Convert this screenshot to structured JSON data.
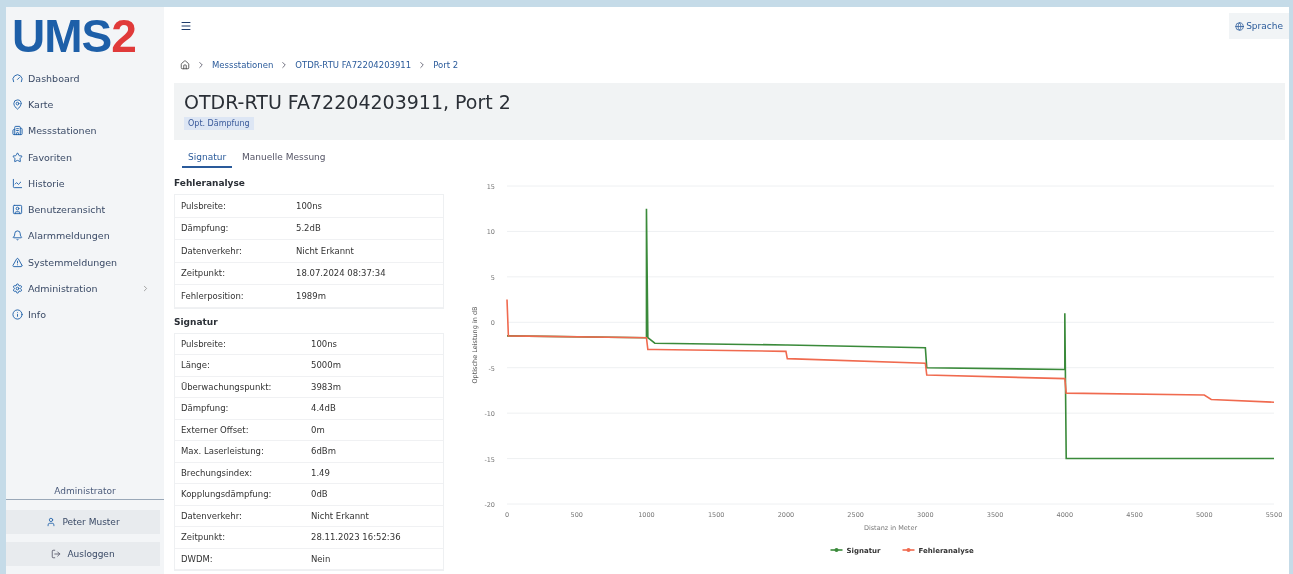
{
  "logo": {
    "text": "UMS",
    "accent": "2"
  },
  "sidebar": {
    "items": [
      {
        "label": "Dashboard",
        "has_submenu": false
      },
      {
        "label": "Karte",
        "has_submenu": false
      },
      {
        "label": "Messstationen",
        "has_submenu": false
      },
      {
        "label": "Favoriten",
        "has_submenu": false
      },
      {
        "label": "Historie",
        "has_submenu": false
      },
      {
        "label": "Benutzeransicht",
        "has_submenu": false
      },
      {
        "label": "Alarmmeldungen",
        "has_submenu": false
      },
      {
        "label": "Systemmeldungen",
        "has_submenu": false
      },
      {
        "label": "Administration",
        "has_submenu": true
      },
      {
        "label": "Info",
        "has_submenu": false
      }
    ],
    "role": "Administrator",
    "user": "Peter Muster",
    "logout": "Ausloggen"
  },
  "header": {
    "language_button": "Sprache"
  },
  "breadcrumb": [
    "Messstationen",
    "OTDR-RTU FA72204203911",
    "Port 2"
  ],
  "title": "OTDR-RTU FA72204203911, Port 2",
  "tag": "Opt. Dämpfung",
  "tabs": [
    {
      "label": "Signatur",
      "selected": true
    },
    {
      "label": "Manuelle Messung",
      "selected": false
    }
  ],
  "sections": [
    {
      "title": "Fehleranalyse",
      "rows": [
        [
          "Pulsbreite:",
          "100ns"
        ],
        [
          "Dämpfung:",
          "5.2dB"
        ],
        [
          "Datenverkehr:",
          "Nicht Erkannt"
        ],
        [
          "Zeitpunkt:",
          "18.07.2024 08:37:34"
        ],
        [
          "Fehlerposition:",
          "1989m"
        ]
      ]
    },
    {
      "title": "Signatur",
      "rows": [
        [
          "Pulsbreite:",
          "100ns"
        ],
        [
          "Länge:",
          "5000m"
        ],
        [
          "Überwachungspunkt:",
          "3983m"
        ],
        [
          "Dämpfung:",
          "4.4dB"
        ],
        [
          "Externer Offset:",
          "0m"
        ],
        [
          "Max. Laserleistung:",
          "6dBm"
        ],
        [
          "Brechungsindex:",
          "1.49"
        ],
        [
          "Kopplungsdämpfung:",
          "0dB"
        ],
        [
          "Datenverkehr:",
          "Nicht Erkannt"
        ],
        [
          "Zeitpunkt:",
          "28.11.2023 16:52:36"
        ],
        [
          "DWDM:",
          "Nein"
        ]
      ]
    }
  ],
  "chart_data": {
    "type": "line",
    "xlabel": "Distanz in Meter",
    "ylabel": "Optische Leistung in dB",
    "x": [
      0,
      10,
      1000,
      1000,
      1010,
      1060,
      2000,
      2010,
      3000,
      3010,
      4000,
      4000,
      4010,
      5000,
      5050,
      5500
    ],
    "series": [
      {
        "name": "Signatur",
        "color": "#3a8a3a",
        "values": [
          -1.5,
          -1.5,
          -1.7,
          12.5,
          -1.7,
          -2.3,
          -2.5,
          -2.5,
          -2.8,
          -5,
          -5.2,
          1,
          -15,
          -15,
          -15,
          -15
        ]
      },
      {
        "name": "Fehleranalyse",
        "color": "#f06a4f",
        "values": [
          2.5,
          -1.5,
          -1.7,
          -1.7,
          -3,
          -3,
          -3.2,
          -4,
          -4.5,
          -5.8,
          -6.2,
          -6.2,
          -7.8,
          -8,
          -8.5,
          -8.8
        ]
      }
    ],
    "xlim": [
      0,
      5500
    ],
    "ylim": [
      -20,
      15
    ],
    "xticks": [
      0,
      500,
      1000,
      1500,
      2000,
      2500,
      3000,
      3500,
      4000,
      4500,
      5000,
      5500
    ],
    "yticks": [
      15,
      10,
      5,
      0,
      -5,
      -10,
      -15,
      -20
    ],
    "grid": true,
    "legend": true
  }
}
